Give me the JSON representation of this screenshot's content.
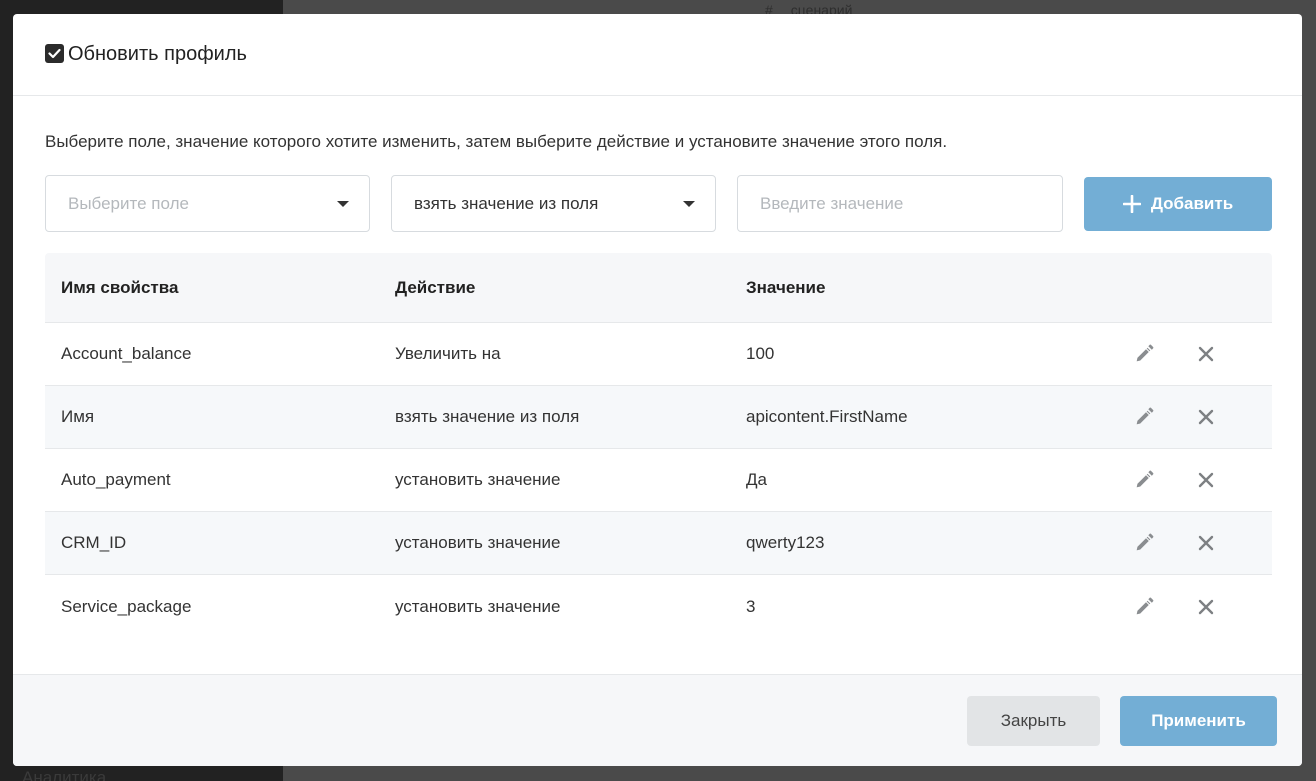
{
  "background": {
    "header_hint": "сценарий",
    "sidebar_hint": "Аналитика"
  },
  "modal": {
    "title": "Обновить профиль",
    "checkbox_checked": true,
    "description": "Выберите поле, значение которого хотите изменить, затем выберите действие и установите значение этого поля.",
    "field_select": {
      "placeholder": "Выберите поле",
      "value": ""
    },
    "action_select": {
      "value": "взять значение из поля"
    },
    "value_input": {
      "placeholder": "Введите значение",
      "value": ""
    },
    "add_button": {
      "label": "Добавить",
      "icon": "plus-icon"
    },
    "table": {
      "headers": {
        "name": "Имя свойства",
        "action": "Действие",
        "value": "Значение"
      },
      "rows": [
        {
          "name": "Account_balance",
          "action": "Увеличить на",
          "value": "100"
        },
        {
          "name": "Имя",
          "action": "взять значение из поля",
          "value": "apicontent.FirstName"
        },
        {
          "name": "Auto_payment",
          "action": "установить значение",
          "value": "Да"
        },
        {
          "name": "CRM_ID",
          "action": "установить значение",
          "value": "qwerty123"
        },
        {
          "name": "Service_package",
          "action": "установить значение",
          "value": "3"
        }
      ],
      "row_icons": [
        "pencil-icon",
        "close-icon"
      ]
    },
    "footer": {
      "close_label": "Закрыть",
      "apply_label": "Применить"
    }
  },
  "colors": {
    "accent": "#73aed5",
    "text": "#333333",
    "border": "#d7dbdf",
    "muted_bg": "#f6f7f9"
  }
}
